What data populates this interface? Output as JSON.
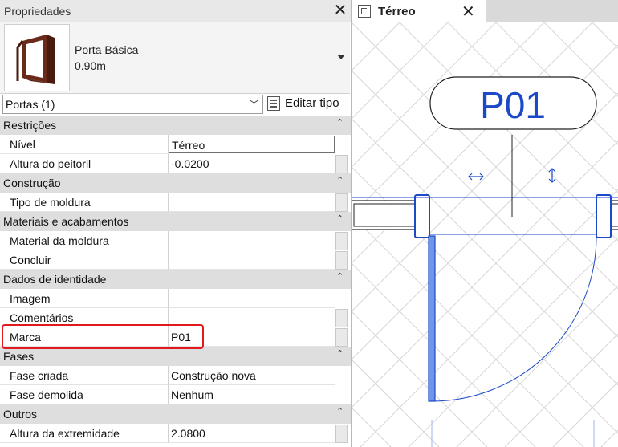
{
  "properties_panel": {
    "title": "Propriedades",
    "type_selector": {
      "name": "Porta Básica",
      "size": "0.90m"
    },
    "filter": {
      "value": "Portas (1)"
    },
    "edit_type_label": "Editar tipo",
    "sections": [
      {
        "label": "Restrições",
        "rows": [
          {
            "name": "Nível",
            "value": "Térreo"
          },
          {
            "name": "Altura do peitoril",
            "value": "-0.0200"
          }
        ]
      },
      {
        "label": "Construção",
        "rows": [
          {
            "name": "Tipo de moldura",
            "value": ""
          }
        ]
      },
      {
        "label": "Materiais e acabamentos",
        "rows": [
          {
            "name": "Material da moldura",
            "value": ""
          },
          {
            "name": "Concluir",
            "value": ""
          }
        ]
      },
      {
        "label": "Dados de identidade",
        "rows": [
          {
            "name": "Imagem",
            "value": ""
          },
          {
            "name": "Comentários",
            "value": ""
          },
          {
            "name": "Marca",
            "value": "P01"
          }
        ]
      },
      {
        "label": "Fases",
        "rows": [
          {
            "name": "Fase criada",
            "value": "Construção nova"
          },
          {
            "name": "Fase demolida",
            "value": "Nenhum"
          }
        ]
      },
      {
        "label": "Outros",
        "rows": [
          {
            "name": "Altura da extremidade",
            "value": "2.0800"
          }
        ]
      }
    ]
  },
  "view": {
    "tab_label": "Térreo",
    "door_tag": "P01",
    "colors": {
      "element_blue": "#1b49c8",
      "door_fill": "#6f97e4",
      "grid": "#d6d6d6"
    }
  }
}
